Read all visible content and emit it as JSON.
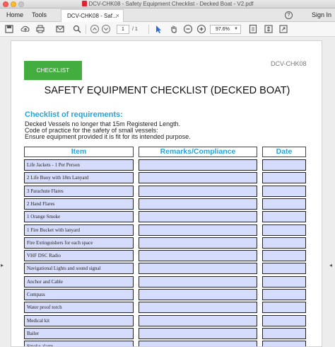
{
  "window": {
    "title": "DCV-CHK08 - Safety Equipment Checklist - Decked Boat - V2.pdf"
  },
  "tabs": {
    "home": "Home",
    "tools": "Tools",
    "document": "DCV-CHK08 - Saf...",
    "help": "?",
    "signin": "Sign In"
  },
  "toolbar": {
    "page_current": "1",
    "page_total": "/ 1",
    "zoom": "97.6%"
  },
  "document": {
    "code": "DCV-CHK08",
    "checklist_label": "CHECKLIST",
    "title": "SAFETY EQUIPMENT CHECKLIST (DECKED BOAT)",
    "requirements_heading": "Checklist of requirements:",
    "requirements": [
      "Decked Vessels no longer that 15m Registered Length.",
      "Code of practice for the safety of small vessels:",
      "Ensure equipment provided it is fit for its intended purpose."
    ],
    "columns": {
      "item": "Item",
      "remarks": "Remarks/Compliance",
      "date": "Date"
    },
    "rows": [
      "Life Jackets  - 1 Per Person",
      "2 Life Buoy with 18m Lanyard",
      "3 Parachute Flares",
      "2 Hand Flares",
      "1 Orange Smoke",
      "1 Fire Bucket with lanyard",
      "Fire Extinguishers for each space",
      "VHF DSC Radio",
      "Navigational Lights and sound signal",
      "Anchor and Cable",
      "Compass",
      "Water proof torch",
      "Medical kit",
      "Bailer",
      "Smoke alarm"
    ]
  },
  "colors": {
    "accent_green": "#43ae3f",
    "heading_blue": "#2ba3d4",
    "field_fill": "#d6dcfb"
  }
}
